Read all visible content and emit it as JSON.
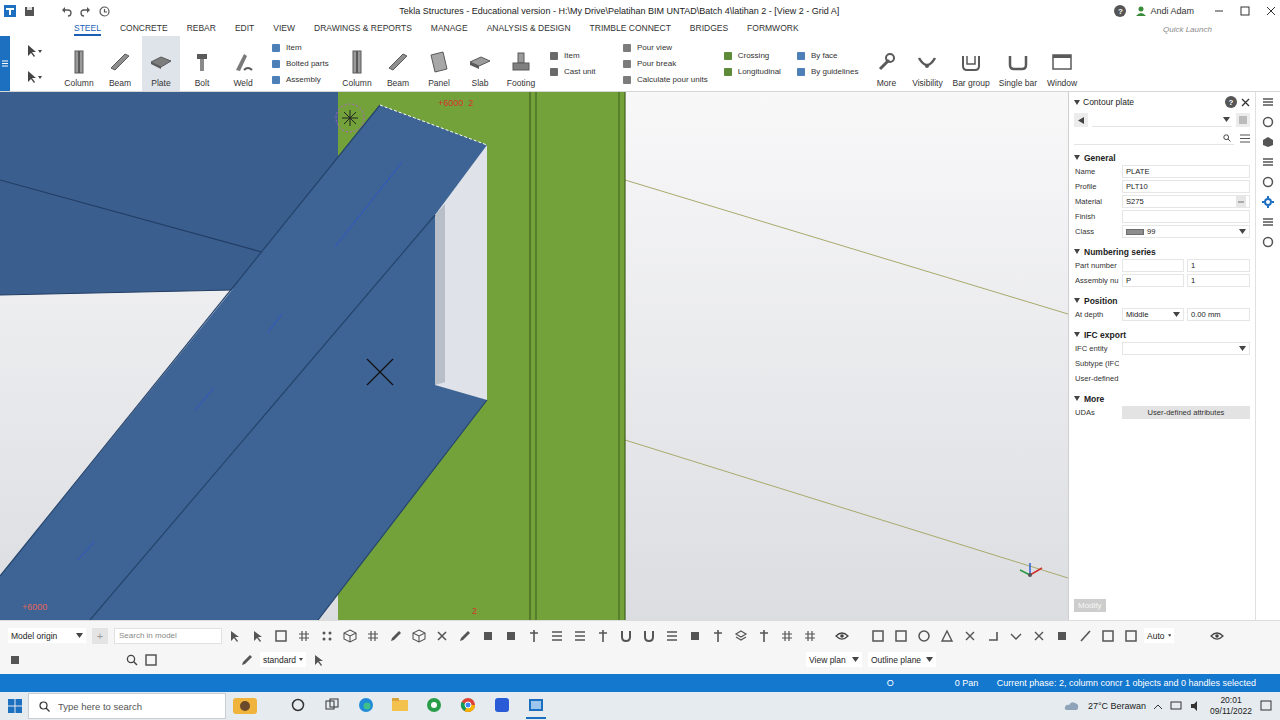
{
  "window": {
    "title": "Tekla Structures - Educational version - H:\\My Drive\\Pelatihan BIM UNTAD\\Batch 4\\latihan 2  - [View 2 - Grid A]",
    "help": "?",
    "user": "Andi Adam"
  },
  "quick_launch": {
    "placeholder": "Quick Launch"
  },
  "menu_tabs": [
    {
      "label": "STEEL",
      "selected": true
    },
    {
      "label": "CONCRETE",
      "selected": false
    },
    {
      "label": "REBAR",
      "selected": false
    },
    {
      "label": "EDIT",
      "selected": false
    },
    {
      "label": "VIEW",
      "selected": false
    },
    {
      "label": "DRAWINGS & REPORTS",
      "selected": false
    },
    {
      "label": "MANAGE",
      "selected": false
    },
    {
      "label": "ANALYSIS & DESIGN",
      "selected": false
    },
    {
      "label": "TRIMBLE CONNECT",
      "selected": false
    },
    {
      "label": "BRIDGES",
      "selected": false
    },
    {
      "label": "FORMWORK",
      "selected": false
    }
  ],
  "ribbon": [
    {
      "kind": "large",
      "label": "Column",
      "selected": false
    },
    {
      "kind": "large",
      "label": "Beam",
      "selected": false
    },
    {
      "kind": "large",
      "label": "Plate",
      "selected": true
    },
    {
      "kind": "large",
      "label": "Bolt",
      "selected": false
    },
    {
      "kind": "large",
      "label": "Weld",
      "selected": false
    },
    {
      "kind": "stack",
      "items": [
        "Item",
        "Bolted parts",
        "Assembly"
      ]
    },
    {
      "kind": "large",
      "label": "Column",
      "selected": false
    },
    {
      "kind": "large",
      "label": "Beam",
      "selected": false
    },
    {
      "kind": "large",
      "label": "Panel",
      "selected": false
    },
    {
      "kind": "large",
      "label": "Slab",
      "selected": false
    },
    {
      "kind": "large",
      "label": "Footing",
      "selected": false
    },
    {
      "kind": "stack",
      "items": [
        "Item",
        "Cast unit"
      ]
    },
    {
      "kind": "stack",
      "items": [
        "Pour view",
        "Pour break",
        "Calculate pour units"
      ]
    },
    {
      "kind": "stack",
      "items": [
        "Crossing",
        "Longitudinal"
      ]
    },
    {
      "kind": "stack",
      "items": [
        "By face",
        "By guidelines"
      ]
    },
    {
      "kind": "large",
      "label": "More",
      "selected": false
    },
    {
      "kind": "large",
      "label": "Visibility",
      "selected": false
    },
    {
      "kind": "large",
      "label": "Bar group",
      "selected": false
    },
    {
      "kind": "large",
      "label": "Single bar",
      "selected": false
    },
    {
      "kind": "large",
      "label": "Window",
      "selected": false
    }
  ],
  "viewport": {
    "labels": [
      {
        "text": "+6000  2"
      },
      {
        "text": "2"
      },
      {
        "text": "+6000"
      }
    ]
  },
  "properties": {
    "title": "Contour plate",
    "help": "?",
    "search_value": "",
    "sections": [
      {
        "title": "General",
        "expanded": true,
        "rows": [
          {
            "kind": "text",
            "label": "Name",
            "value": "PLATE"
          },
          {
            "kind": "text",
            "label": "Profile",
            "value": "PLT10"
          },
          {
            "kind": "browse",
            "label": "Material",
            "value": "S275"
          },
          {
            "kind": "text",
            "label": "Finish",
            "value": ""
          },
          {
            "kind": "class",
            "label": "Class",
            "value": "99"
          }
        ]
      },
      {
        "title": "Numbering series",
        "expanded": true,
        "rows": [
          {
            "kind": "pair",
            "label": "Part number",
            "prefix": "",
            "start": "1"
          },
          {
            "kind": "pair",
            "label": "Assembly nu",
            "prefix": "P",
            "start": "1"
          }
        ]
      },
      {
        "title": "Position",
        "expanded": true,
        "rows": [
          {
            "kind": "select-value",
            "label": "At depth",
            "option": "Middle",
            "value": "0.00 mm"
          }
        ]
      },
      {
        "title": "IFC export",
        "expanded": true,
        "rows": [
          {
            "kind": "select",
            "label": "IFC entity",
            "value": ""
          },
          {
            "kind": "label",
            "label": "Subtype (IFC"
          },
          {
            "kind": "label",
            "label": "User-defined"
          }
        ]
      },
      {
        "title": "More",
        "expanded": true,
        "rows": [
          {
            "kind": "button",
            "label": "UDAs",
            "value": "User-defined attributes"
          }
        ]
      }
    ],
    "modify": {
      "label": "Modify",
      "disabled": true
    }
  },
  "side_tools": [
    {
      "selected": false
    },
    {
      "selected": false
    },
    {
      "selected": false
    },
    {
      "selected": false
    },
    {
      "selected": false
    },
    {
      "selected": true
    },
    {
      "selected": false
    },
    {
      "selected": false
    }
  ],
  "bottom_toolbar": {
    "origin": "Model origin",
    "add": "+",
    "search_placeholder": "Search in model",
    "filter": "standard",
    "view_plan": "View plan",
    "outline_plane": "Outline plane",
    "auto": "Auto"
  },
  "status_bar": {
    "left": "O",
    "mode": "0 Pan",
    "message": "Current phase: 2, column concr 1 objects and 0 handles selected"
  },
  "taskbar": {
    "search_placeholder": "Type here to search",
    "weather": "27°C  Berawan",
    "time": "20:01",
    "date": "09/11/2022"
  }
}
